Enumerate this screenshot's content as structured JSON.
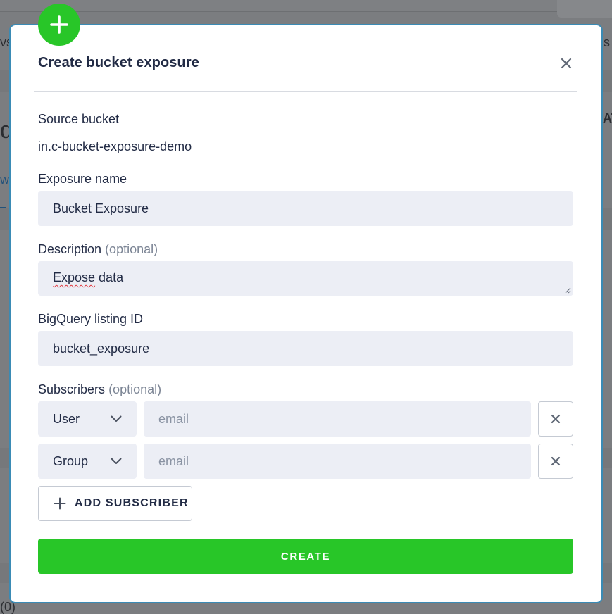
{
  "background": {
    "fragments": [
      "vs",
      "s",
      "d",
      "AT",
      "w",
      "(0)"
    ]
  },
  "modal": {
    "title": "Create bucket exposure",
    "source_bucket": {
      "label": "Source bucket",
      "value": "in.c-bucket-exposure-demo"
    },
    "exposure_name": {
      "label": "Exposure name",
      "value": "Bucket Exposure"
    },
    "description": {
      "label": "Description",
      "optional": "(optional)",
      "value_word1": "Expose",
      "value_rest": " data"
    },
    "listing_id": {
      "label": "BigQuery listing ID",
      "value": "bucket_exposure"
    },
    "subscribers": {
      "label": "Subscribers",
      "optional": "(optional)",
      "rows": [
        {
          "type": "User",
          "email_placeholder": "email"
        },
        {
          "type": "Group",
          "email_placeholder": "email"
        }
      ],
      "add_label": "ADD SUBSCRIBER"
    },
    "create_label": "CREATE"
  },
  "colors": {
    "accent_green": "#28c628",
    "modal_border": "#3a8bb5",
    "field_bg": "#eceef5"
  },
  "icons": {
    "badge": "plus-icon",
    "close": "close-icon",
    "select": "chevron-down-icon",
    "remove": "x-icon",
    "add": "plus-icon"
  }
}
